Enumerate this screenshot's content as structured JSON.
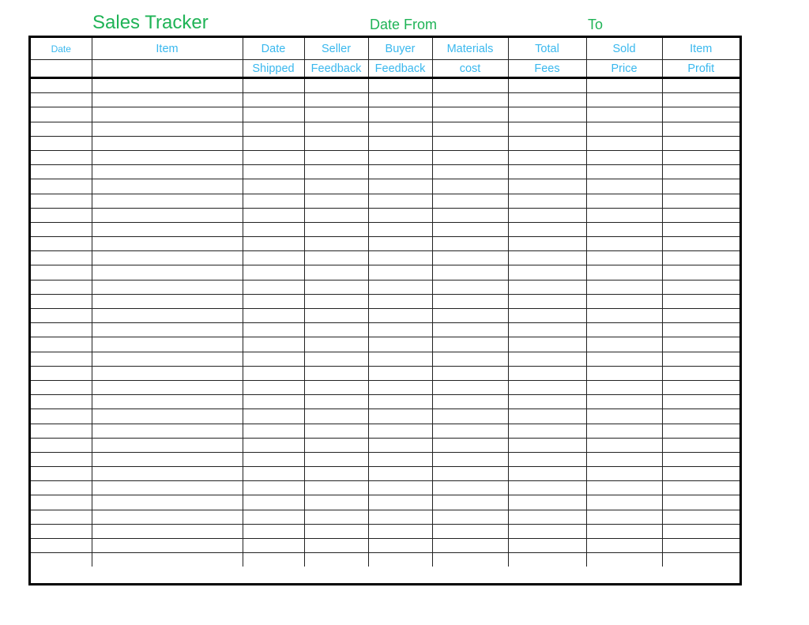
{
  "header": {
    "title": "Sales Tracker",
    "date_from_label": "Date From",
    "to_label": "To"
  },
  "colors": {
    "title": "#1fb356",
    "column_header": "#3ab8ee",
    "grid": "#000000"
  },
  "table": {
    "columns": [
      {
        "line1": "Date",
        "line2": ""
      },
      {
        "line1": "Item",
        "line2": ""
      },
      {
        "line1": "Date",
        "line2": "Shipped"
      },
      {
        "line1": "Seller",
        "line2": "Feedback"
      },
      {
        "line1": "Buyer",
        "line2": "Feedback"
      },
      {
        "line1": "Materials",
        "line2": "cost"
      },
      {
        "line1": "Total",
        "line2": "Fees"
      },
      {
        "line1": "Sold",
        "line2": "Price"
      },
      {
        "line1": "Item",
        "line2": "Profit"
      }
    ],
    "row_count": 34,
    "rows": []
  }
}
